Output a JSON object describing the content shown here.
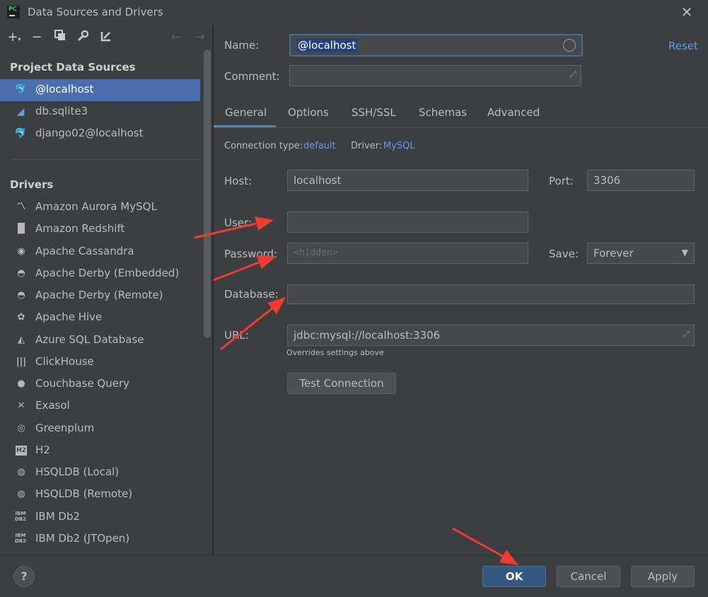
{
  "window": {
    "title": "Data Sources and Drivers",
    "app_icon_text": "PC"
  },
  "left": {
    "project_section_title": "Project Data Sources",
    "data_sources": [
      {
        "label": "@localhost",
        "icon": "mysql-icon"
      },
      {
        "label": "db.sqlite3",
        "icon": "sqlite-icon"
      },
      {
        "label": "django02@localhost",
        "icon": "mysql-icon"
      }
    ],
    "drivers_section_title": "Drivers",
    "drivers": [
      {
        "label": "Amazon Aurora MySQL",
        "icon": "aurora-icon"
      },
      {
        "label": "Amazon Redshift",
        "icon": "redshift-icon"
      },
      {
        "label": "Apache Cassandra",
        "icon": "cassandra-icon"
      },
      {
        "label": "Apache Derby (Embedded)",
        "icon": "derby-icon"
      },
      {
        "label": "Apache Derby (Remote)",
        "icon": "derby-icon"
      },
      {
        "label": "Apache Hive",
        "icon": "hive-icon"
      },
      {
        "label": "Azure SQL Database",
        "icon": "azure-icon"
      },
      {
        "label": "ClickHouse",
        "icon": "clickhouse-icon"
      },
      {
        "label": "Couchbase Query",
        "icon": "couchbase-icon"
      },
      {
        "label": "Exasol",
        "icon": "exasol-icon"
      },
      {
        "label": "Greenplum",
        "icon": "greenplum-icon"
      },
      {
        "label": "H2",
        "icon": "h2-icon",
        "badge": "H2"
      },
      {
        "label": "HSQLDB (Local)",
        "icon": "hsqldb-icon"
      },
      {
        "label": "HSQLDB (Remote)",
        "icon": "hsqldb-icon"
      },
      {
        "label": "IBM Db2",
        "icon": "ibm-db2-icon",
        "badge": "IBM DB2"
      },
      {
        "label": "IBM Db2 (JTOpen)",
        "icon": "ibm-db2-icon",
        "badge": "IBM DB2"
      }
    ]
  },
  "form": {
    "name_label": "Name:",
    "name_value": "@localhost",
    "reset_label": "Reset",
    "comment_label": "Comment:",
    "comment_value": "",
    "tabs": [
      "General",
      "Options",
      "SSH/SSL",
      "Schemas",
      "Advanced"
    ],
    "active_tab": "General",
    "connection_type_label": "Connection type:",
    "connection_type_value": "default",
    "driver_label": "Driver:",
    "driver_value": "MySQL",
    "host_label": "Host:",
    "host_value": "localhost",
    "port_label": "Port:",
    "port_value": "3306",
    "user_label": "User:",
    "user_value": "",
    "password_label": "Password:",
    "password_placeholder": "<hidden>",
    "save_label": "Save:",
    "save_value": "Forever",
    "database_label": "Database:",
    "database_value": "",
    "url_label": "URL:",
    "url_value": "jdbc:mysql://localhost:3306",
    "url_hint": "Overrides settings above",
    "test_connection_label": "Test Connection"
  },
  "footer": {
    "help_label": "?",
    "ok_label": "OK",
    "cancel_label": "Cancel",
    "apply_label": "Apply"
  },
  "colors": {
    "selection": "#4b6eaf",
    "link": "#589df6",
    "annotation_arrow": "#f03c30",
    "ok_button": "#365880"
  }
}
